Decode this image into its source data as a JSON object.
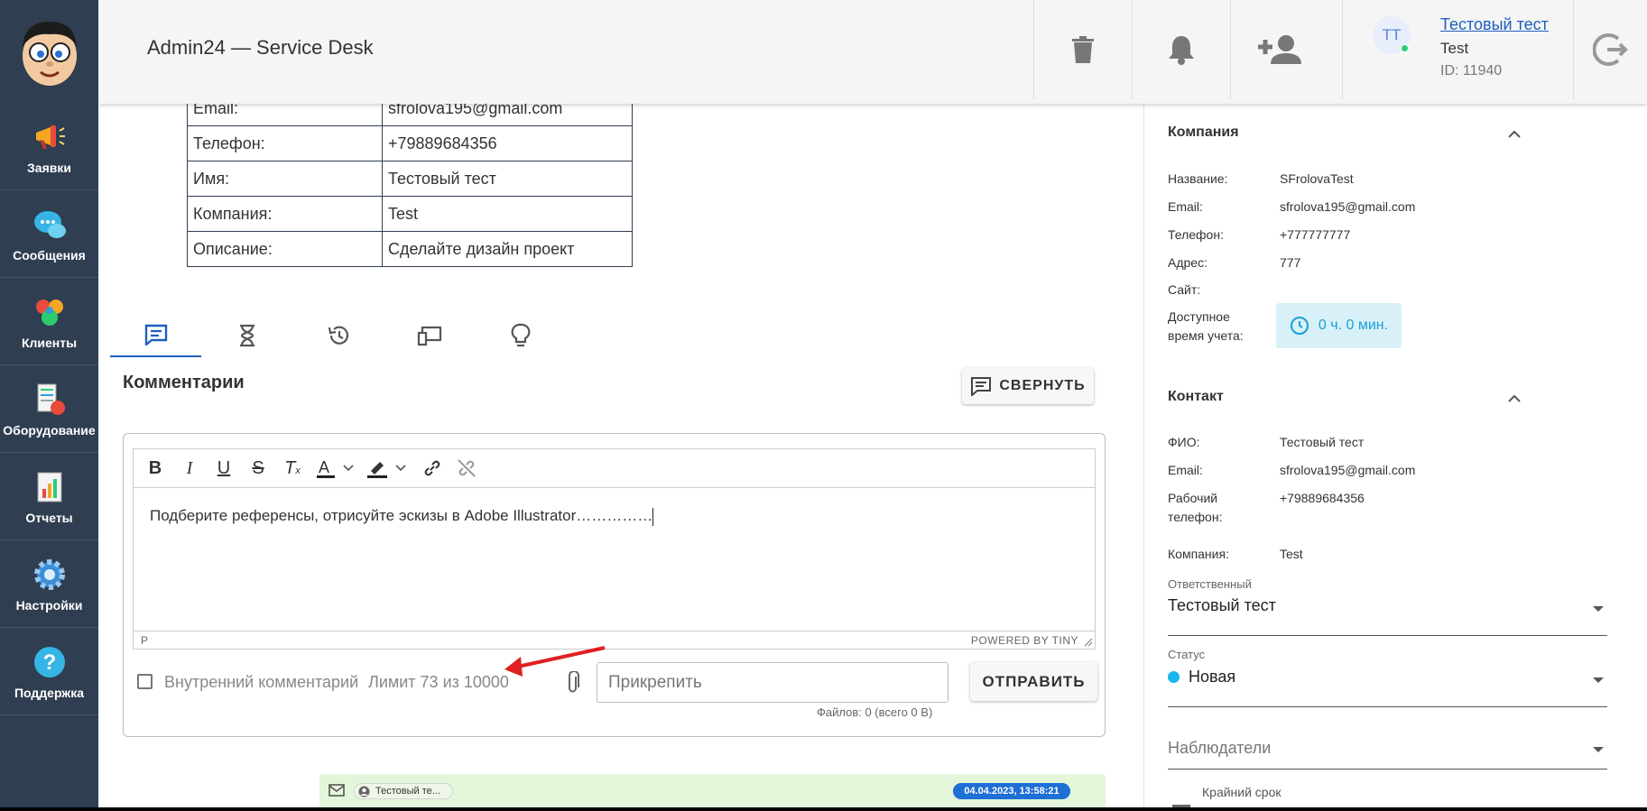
{
  "header": {
    "app_title": "Admin24 — Service Desk",
    "user": {
      "initials": "ТТ",
      "name": "Тестовый тест",
      "company": "Test",
      "id_label": "ID: 11940"
    }
  },
  "sidebar": {
    "items": [
      {
        "label": "Заявки",
        "icon": "megaphone-icon"
      },
      {
        "label": "Сообщения",
        "icon": "chat-bubbles-icon"
      },
      {
        "label": "Клиенты",
        "icon": "clients-icon"
      },
      {
        "label": "Оборудование",
        "icon": "equipment-icon"
      },
      {
        "label": "Отчеты",
        "icon": "report-chart-icon"
      },
      {
        "label": "Настройки",
        "icon": "gear-icon"
      },
      {
        "label": "Поддержка",
        "icon": "help-question-icon"
      }
    ]
  },
  "request_info": {
    "rows": [
      {
        "key": "Email:",
        "value": "sfrolova195@gmail.com"
      },
      {
        "key": "Телефон:",
        "value": "+79889684356"
      },
      {
        "key": "Имя:",
        "value": "Тестовый тест"
      },
      {
        "key": "Компания:",
        "value": "Test"
      },
      {
        "key": "Описание:",
        "value": "Сделайте дизайн проект"
      }
    ]
  },
  "tabs": [
    {
      "icon": "comment-icon",
      "active": true
    },
    {
      "icon": "hourglass-icon",
      "active": false
    },
    {
      "icon": "history-icon",
      "active": false
    },
    {
      "icon": "devices-icon",
      "active": false
    },
    {
      "icon": "lightbulb-icon",
      "active": false
    }
  ],
  "comments": {
    "title": "Комментарии",
    "collapse_label": "СВЕРНУТЬ",
    "editor": {
      "content": "Подберите референсы, отрисуйте эскизы в Adobe Illustrator……………",
      "path": "P",
      "powered": "POWERED BY TINY"
    },
    "internal_label": "Внутренний комментарий",
    "limit_text": "Лимит 73 из 10000",
    "attach_placeholder": "Прикрепить",
    "files_info": "Файлов: 0 (всего 0 B)",
    "send_label": "ОТПРАВИТЬ"
  },
  "comment_preview": {
    "author": "Тестовый те...",
    "date": "04.04.2023, 13:58:21"
  },
  "right_panel": {
    "company": {
      "title": "Компания",
      "name_label": "Название:",
      "name": "SFrolovaTest",
      "email_label": "Email:",
      "email": "sfrolova195@gmail.com",
      "phone_label": "Телефон:",
      "phone": "+777777777",
      "address_label": "Адрес:",
      "address": "777",
      "site_label": "Сайт:",
      "time_label_1": "Доступное",
      "time_label_2": "время учета:",
      "time_value": "0 ч. 0 мин."
    },
    "contact": {
      "title": "Контакт",
      "fio_label": "ФИО:",
      "fio": "Тестовый тест",
      "email_label": "Email:",
      "email": "sfrolova195@gmail.com",
      "work_phone_label_1": "Рабочий",
      "work_phone_label_2": "телефон:",
      "work_phone": "+79889684356",
      "company_label": "Компания:",
      "company": "Test"
    },
    "responsible": {
      "label": "Ответственный",
      "value": "Тестовый тест"
    },
    "status": {
      "label": "Статус",
      "value": "Новая",
      "color": "#1ab4ef"
    },
    "observers": {
      "placeholder": "Наблюдатели"
    },
    "deadline": {
      "label": "Крайний срок"
    }
  },
  "colors": {
    "sidebar_bg": "#2f3e51",
    "accent_blue": "#1e5fbf",
    "annotation_red": "#e02020"
  }
}
